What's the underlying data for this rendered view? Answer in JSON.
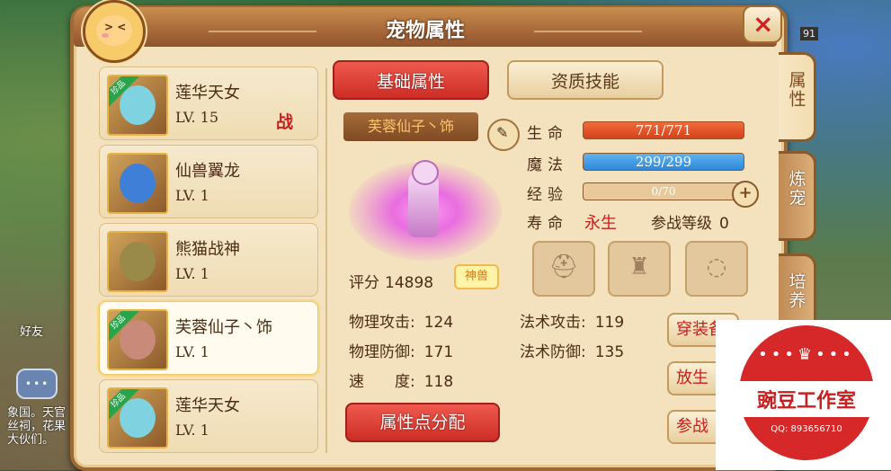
{
  "window": {
    "title": "宠物属性",
    "close_icon": "×"
  },
  "background": {
    "left_text": "象国。天官\n丝祠，花果\n大伙们。",
    "chat_icon": "•••",
    "friend_label": "好友",
    "level_badge": "91"
  },
  "side_tabs": [
    {
      "label": "属性",
      "active": true
    },
    {
      "label": "炼宠",
      "active": false
    },
    {
      "label": "培养",
      "active": false
    }
  ],
  "pet_list": [
    {
      "name": "莲华天女",
      "level": "LV. 15",
      "rare": true,
      "rare_label": "珍品",
      "battle": "战",
      "selected": false,
      "face_color": "#7fd3e0"
    },
    {
      "name": "仙兽翼龙",
      "level": "LV. 1",
      "rare": false,
      "battle": "",
      "selected": false,
      "face_color": "#3f7fd8"
    },
    {
      "name": "熊猫战神",
      "level": "LV. 1",
      "rare": false,
      "battle": "",
      "selected": false,
      "face_color": "#9a8a4a"
    },
    {
      "name": "芙蓉仙子丶饰",
      "level": "LV. 1",
      "rare": true,
      "rare_label": "珍品",
      "battle": "",
      "selected": true,
      "face_color": "#c98a7a"
    },
    {
      "name": "莲华天女",
      "level": "LV. 1",
      "rare": true,
      "rare_label": "珍品",
      "battle": "",
      "selected": false,
      "face_color": "#7fd3e0"
    }
  ],
  "tabs": {
    "basic": "基础属性",
    "aptitude": "资质技能"
  },
  "pet_detail": {
    "name": "芙蓉仙子丶饰",
    "score_label": "评分",
    "score": "14898",
    "type_badge": "神兽",
    "edit_icon": "✎"
  },
  "stats": {
    "hp_label": "生命",
    "hp": "771/771",
    "hp_fraction": 1.0,
    "mp_label": "魔法",
    "mp": "299/299",
    "mp_fraction": 1.0,
    "exp_label": "经验",
    "exp": "0/70",
    "exp_fraction": 0.0,
    "life_label": "寿命",
    "life": "永生",
    "battle_level_label": "参战等级",
    "battle_level": "0",
    "plus": "+"
  },
  "equipment": [
    {
      "icon": "helmet-icon",
      "glyph": "⛑"
    },
    {
      "icon": "armor-icon",
      "glyph": "♜"
    },
    {
      "icon": "necklace-icon",
      "glyph": "◌"
    }
  ],
  "attributes": {
    "phys_atk_label": "物理攻击:",
    "phys_atk": "124",
    "phys_def_label": "物理防御:",
    "phys_def": "171",
    "speed_label": "速　　度:",
    "speed": "118",
    "mag_atk_label": "法术攻击:",
    "mag_atk": "119",
    "mag_def_label": "法术防御:",
    "mag_def": "135"
  },
  "buttons": {
    "allocate": "属性点分配",
    "wear": "穿装备",
    "release": "放生",
    "join": "参战"
  },
  "watermark": {
    "name": "豌豆工作室",
    "qq": "QQ: 893656710",
    "crown": "•••♛•••"
  },
  "colors": {
    "accent_red": "#cc2d25",
    "hp": "#d6421c",
    "mp": "#2f87d6",
    "panel": "#f3e2bd"
  }
}
